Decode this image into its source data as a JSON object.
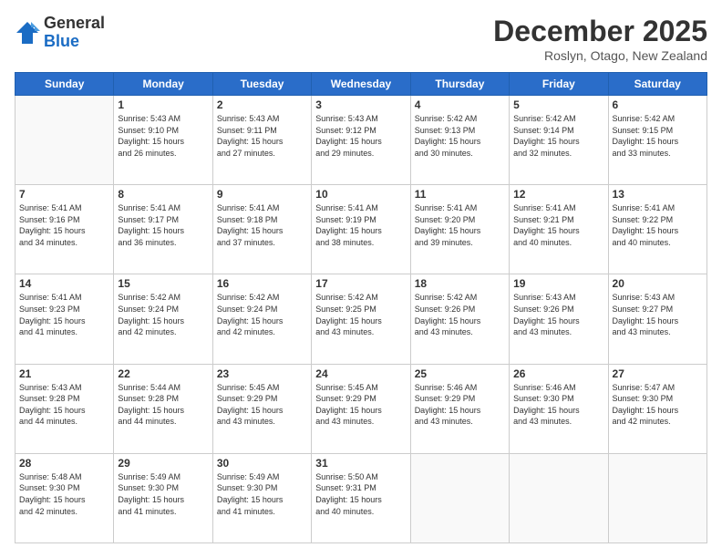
{
  "logo": {
    "general": "General",
    "blue": "Blue"
  },
  "title": "December 2025",
  "location": "Roslyn, Otago, New Zealand",
  "days_of_week": [
    "Sunday",
    "Monday",
    "Tuesday",
    "Wednesday",
    "Thursday",
    "Friday",
    "Saturday"
  ],
  "weeks": [
    [
      {
        "day": "",
        "info": ""
      },
      {
        "day": "1",
        "info": "Sunrise: 5:43 AM\nSunset: 9:10 PM\nDaylight: 15 hours\nand 26 minutes."
      },
      {
        "day": "2",
        "info": "Sunrise: 5:43 AM\nSunset: 9:11 PM\nDaylight: 15 hours\nand 27 minutes."
      },
      {
        "day": "3",
        "info": "Sunrise: 5:43 AM\nSunset: 9:12 PM\nDaylight: 15 hours\nand 29 minutes."
      },
      {
        "day": "4",
        "info": "Sunrise: 5:42 AM\nSunset: 9:13 PM\nDaylight: 15 hours\nand 30 minutes."
      },
      {
        "day": "5",
        "info": "Sunrise: 5:42 AM\nSunset: 9:14 PM\nDaylight: 15 hours\nand 32 minutes."
      },
      {
        "day": "6",
        "info": "Sunrise: 5:42 AM\nSunset: 9:15 PM\nDaylight: 15 hours\nand 33 minutes."
      }
    ],
    [
      {
        "day": "7",
        "info": "Sunrise: 5:41 AM\nSunset: 9:16 PM\nDaylight: 15 hours\nand 34 minutes."
      },
      {
        "day": "8",
        "info": "Sunrise: 5:41 AM\nSunset: 9:17 PM\nDaylight: 15 hours\nand 36 minutes."
      },
      {
        "day": "9",
        "info": "Sunrise: 5:41 AM\nSunset: 9:18 PM\nDaylight: 15 hours\nand 37 minutes."
      },
      {
        "day": "10",
        "info": "Sunrise: 5:41 AM\nSunset: 9:19 PM\nDaylight: 15 hours\nand 38 minutes."
      },
      {
        "day": "11",
        "info": "Sunrise: 5:41 AM\nSunset: 9:20 PM\nDaylight: 15 hours\nand 39 minutes."
      },
      {
        "day": "12",
        "info": "Sunrise: 5:41 AM\nSunset: 9:21 PM\nDaylight: 15 hours\nand 40 minutes."
      },
      {
        "day": "13",
        "info": "Sunrise: 5:41 AM\nSunset: 9:22 PM\nDaylight: 15 hours\nand 40 minutes."
      }
    ],
    [
      {
        "day": "14",
        "info": "Sunrise: 5:41 AM\nSunset: 9:23 PM\nDaylight: 15 hours\nand 41 minutes."
      },
      {
        "day": "15",
        "info": "Sunrise: 5:42 AM\nSunset: 9:24 PM\nDaylight: 15 hours\nand 42 minutes."
      },
      {
        "day": "16",
        "info": "Sunrise: 5:42 AM\nSunset: 9:24 PM\nDaylight: 15 hours\nand 42 minutes."
      },
      {
        "day": "17",
        "info": "Sunrise: 5:42 AM\nSunset: 9:25 PM\nDaylight: 15 hours\nand 43 minutes."
      },
      {
        "day": "18",
        "info": "Sunrise: 5:42 AM\nSunset: 9:26 PM\nDaylight: 15 hours\nand 43 minutes."
      },
      {
        "day": "19",
        "info": "Sunrise: 5:43 AM\nSunset: 9:26 PM\nDaylight: 15 hours\nand 43 minutes."
      },
      {
        "day": "20",
        "info": "Sunrise: 5:43 AM\nSunset: 9:27 PM\nDaylight: 15 hours\nand 43 minutes."
      }
    ],
    [
      {
        "day": "21",
        "info": "Sunrise: 5:43 AM\nSunset: 9:28 PM\nDaylight: 15 hours\nand 44 minutes."
      },
      {
        "day": "22",
        "info": "Sunrise: 5:44 AM\nSunset: 9:28 PM\nDaylight: 15 hours\nand 44 minutes."
      },
      {
        "day": "23",
        "info": "Sunrise: 5:45 AM\nSunset: 9:29 PM\nDaylight: 15 hours\nand 43 minutes."
      },
      {
        "day": "24",
        "info": "Sunrise: 5:45 AM\nSunset: 9:29 PM\nDaylight: 15 hours\nand 43 minutes."
      },
      {
        "day": "25",
        "info": "Sunrise: 5:46 AM\nSunset: 9:29 PM\nDaylight: 15 hours\nand 43 minutes."
      },
      {
        "day": "26",
        "info": "Sunrise: 5:46 AM\nSunset: 9:30 PM\nDaylight: 15 hours\nand 43 minutes."
      },
      {
        "day": "27",
        "info": "Sunrise: 5:47 AM\nSunset: 9:30 PM\nDaylight: 15 hours\nand 42 minutes."
      }
    ],
    [
      {
        "day": "28",
        "info": "Sunrise: 5:48 AM\nSunset: 9:30 PM\nDaylight: 15 hours\nand 42 minutes."
      },
      {
        "day": "29",
        "info": "Sunrise: 5:49 AM\nSunset: 9:30 PM\nDaylight: 15 hours\nand 41 minutes."
      },
      {
        "day": "30",
        "info": "Sunrise: 5:49 AM\nSunset: 9:30 PM\nDaylight: 15 hours\nand 41 minutes."
      },
      {
        "day": "31",
        "info": "Sunrise: 5:50 AM\nSunset: 9:31 PM\nDaylight: 15 hours\nand 40 minutes."
      },
      {
        "day": "",
        "info": ""
      },
      {
        "day": "",
        "info": ""
      },
      {
        "day": "",
        "info": ""
      }
    ]
  ]
}
